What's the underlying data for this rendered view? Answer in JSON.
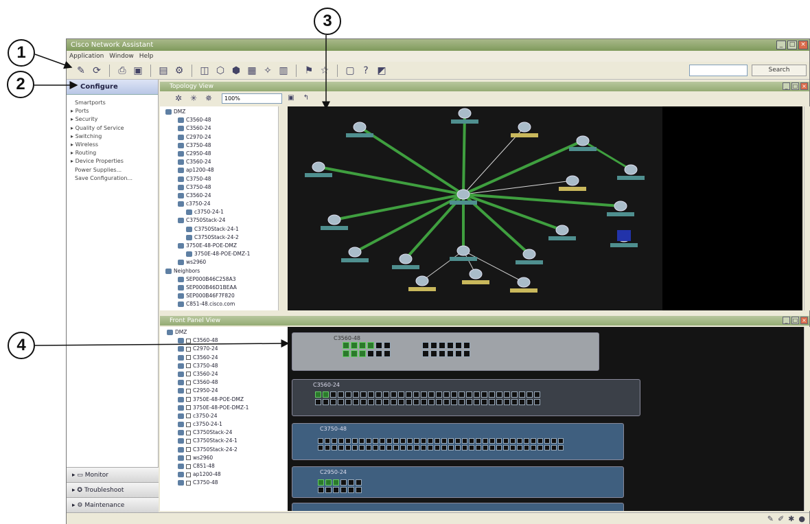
{
  "callouts": [
    "1",
    "2",
    "3",
    "4"
  ],
  "window": {
    "title": "Cisco Network Assistant"
  },
  "menu": [
    "Application",
    "Window",
    "Help"
  ],
  "toolbar": {
    "search_placeholder": "",
    "search_button": "Search"
  },
  "configure": {
    "label": "Configure",
    "items": [
      "Smartports",
      "Ports",
      "Security",
      "Quality of Service",
      "Switching",
      "Wireless",
      "Routing",
      "Device Properties",
      "Power Supplies...",
      "Save Configuration..."
    ]
  },
  "accordion": [
    {
      "label": "Monitor"
    },
    {
      "label": "Troubleshoot"
    },
    {
      "label": "Maintenance"
    }
  ],
  "topology": {
    "title": "Topology View",
    "zoom": "100%",
    "tree": [
      "DMZ",
      "C3560-48",
      "C3560-24",
      "C2970-24",
      "C3750-48",
      "C2950-48",
      "C3560-24",
      "ap1200-48",
      "C3750-48",
      "C3750-48",
      "C3560-24",
      "c3750-24",
      "c3750-24-1",
      "C3750Stack-24",
      "C3750Stack-24-1",
      "C3750Stack-24-2",
      "3750E-48-POE-DMZ",
      "3750E-48-POE-DMZ-1",
      "ws2960",
      "Neighbors",
      "SEP000B46C258A3",
      "SEP000B46D1BEAA",
      "SEP000B46F7F820",
      "C851-48.cisco.com"
    ]
  },
  "device_view": {
    "title": "Front Panel View",
    "tree": [
      "DMZ",
      "C3560-48",
      "C2970-24",
      "C3560-24",
      "C3750-48",
      "C3560-24",
      "C3560-48",
      "C2950-24",
      "3750E-48-POE-DMZ",
      "3750E-48-POE-DMZ-1",
      "c3750-24",
      "c3750-24-1",
      "C3750Stack-24",
      "C3750Stack-24-1",
      "C3750Stack-24-2",
      "ws2960",
      "C851-48",
      "ap1200-48",
      "C3750-48"
    ],
    "switches": [
      "C3560-48",
      "C3560-24",
      "C3750-48",
      "C2950-24"
    ]
  }
}
